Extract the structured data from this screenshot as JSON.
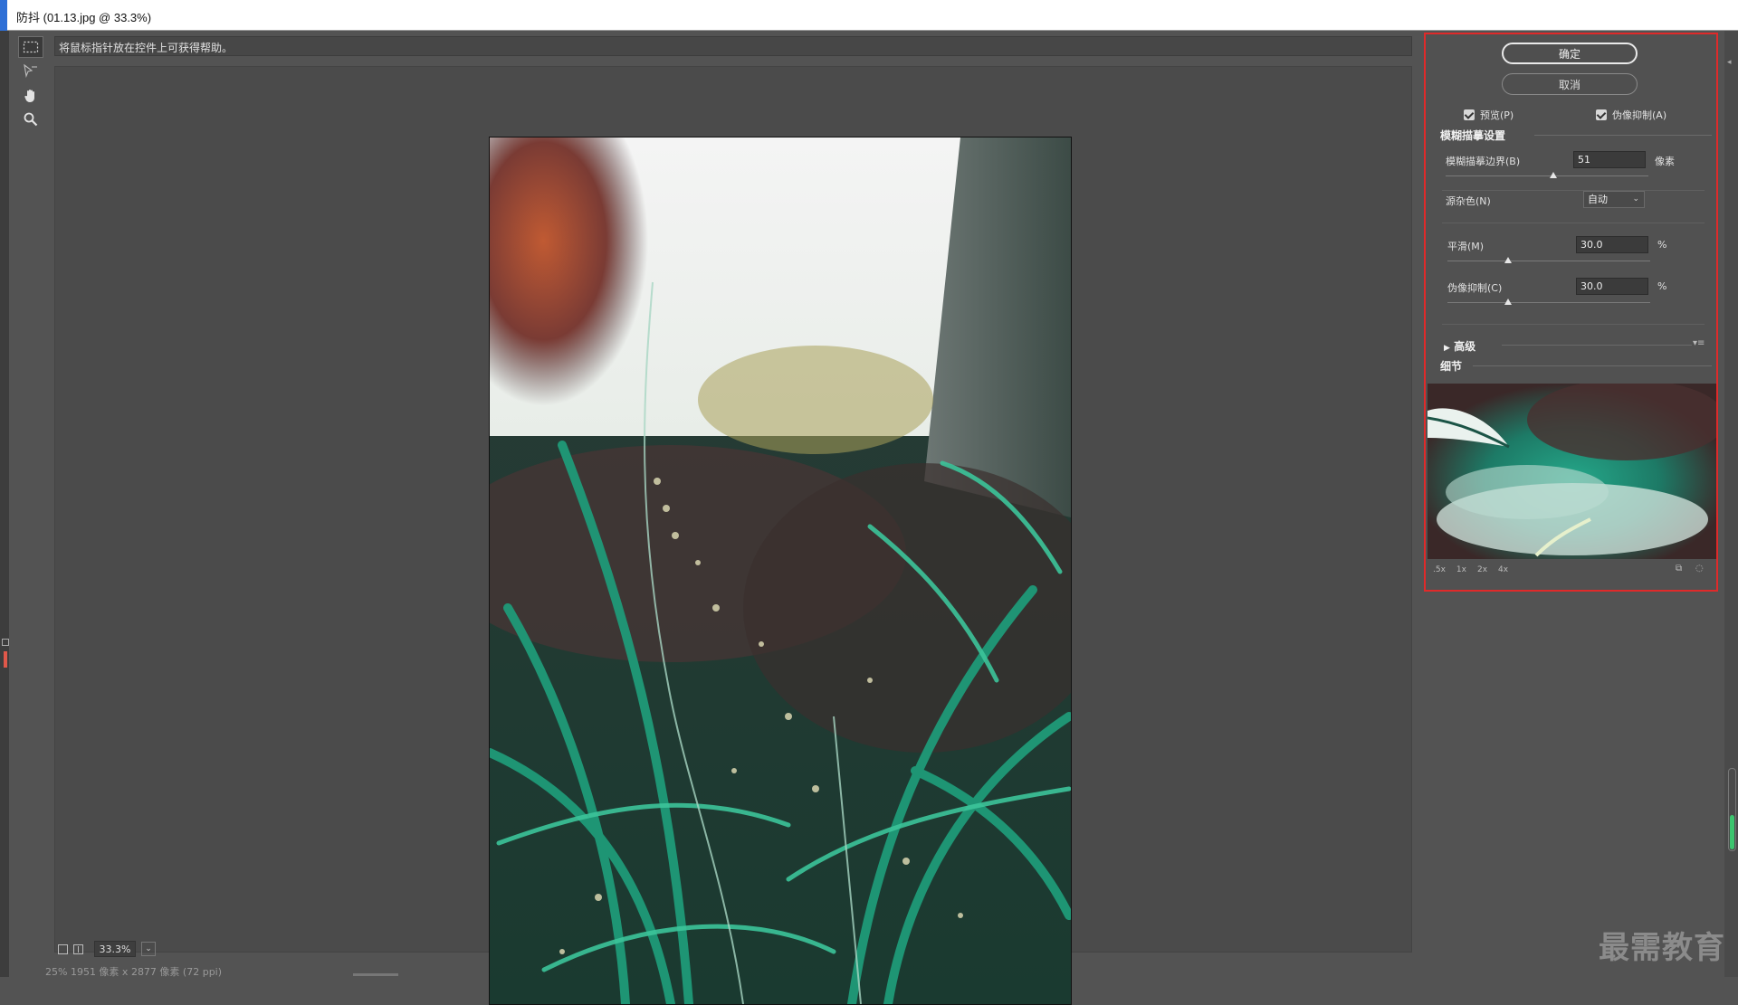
{
  "window": {
    "title": "防抖 (01.13.jpg @ 33.3%)"
  },
  "tools": {
    "items": [
      "marquee-icon",
      "blur-trace-icon",
      "hand-icon",
      "zoom-icon"
    ]
  },
  "hint": {
    "text": "将鼠标指针放在控件上可获得帮助。"
  },
  "zoom": {
    "value": "33.3%",
    "dropdown_glyph": "⌄"
  },
  "status": {
    "text": "25% 1951 像素 x 2877 像素 (72 ppi)"
  },
  "panel": {
    "ok_label": "确定",
    "cancel_label": "取消",
    "preview_label": "预览(P)",
    "artifact_label": "伪像抑制(A)",
    "blur_section": "模糊描摹设置",
    "blur_bounds_label": "模糊描摹边界(B)",
    "blur_bounds_value": "51",
    "blur_bounds_unit": "像素",
    "blur_bounds_level": 0.53,
    "source_noise_label": "源杂色(N)",
    "source_noise_value": "自动",
    "smooth_label": "平滑(M)",
    "smooth_value": "30.0",
    "smooth_unit": "%",
    "smooth_level": 0.3,
    "artifact_supp_label": "伪像抑制(C)",
    "artifact_supp_value": "30.0",
    "artifact_supp_unit": "%",
    "artifact_supp_level": 0.3,
    "advanced_label": "高级",
    "advanced_arrow": "▶",
    "detail_label": "细节",
    "zoom_options": [
      ".5x",
      "1x",
      "2x",
      "4x"
    ],
    "menu_glyph": "▾≡"
  },
  "watermark": {
    "text": "最需教育"
  },
  "colors": {
    "panel_highlight": "#e02a2a",
    "background": "#535353"
  }
}
